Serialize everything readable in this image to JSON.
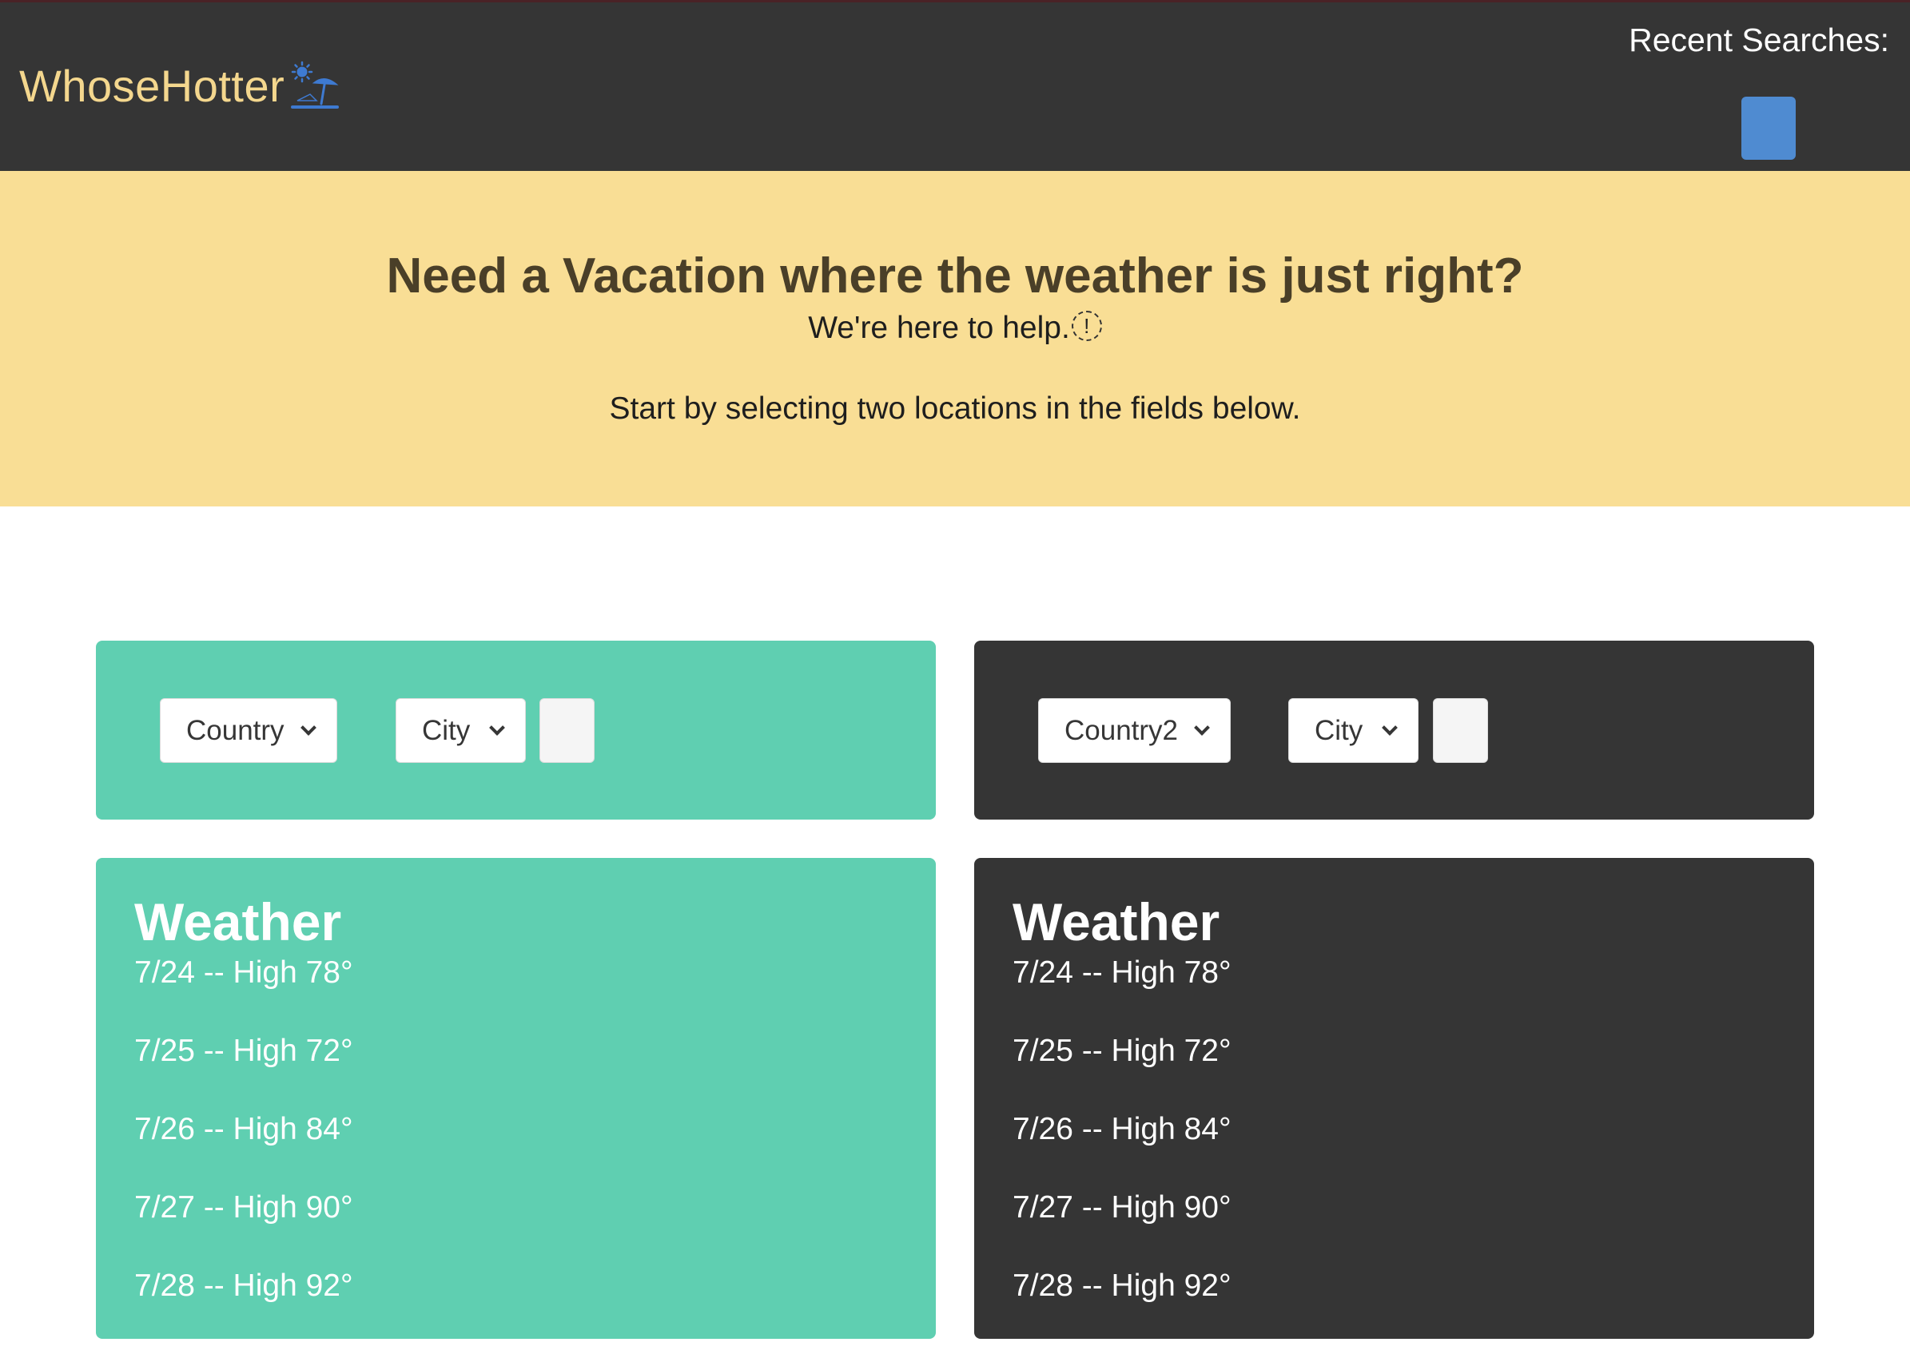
{
  "navbar": {
    "brand": "WhoseHotter",
    "brand_icon": "beach-umbrella-icon",
    "recent_label": "Recent Searches:"
  },
  "hero": {
    "title": "Need a Vacation where the weather is just right?",
    "subtitle": "We're here to help.",
    "info_icon": "!",
    "instruction": "Start by selecting two locations in the fields below."
  },
  "location1": {
    "country_placeholder": "Country",
    "city_placeholder": "City",
    "color": "#5fcfb1"
  },
  "location2": {
    "country_placeholder": "Country2",
    "city_placeholder": "City",
    "color": "#353535"
  },
  "weather1": {
    "title": "Weather",
    "forecast": [
      "7/24 -- High 78°",
      "7/25 -- High 72°",
      "7/26 -- High 84°",
      "7/27 -- High 90°",
      "7/28 -- High 92°"
    ]
  },
  "weather2": {
    "title": "Weather",
    "forecast": [
      "7/24 -- High 78°",
      "7/25 -- High 72°",
      "7/26 -- High 84°",
      "7/27 -- High 90°",
      "7/28 -- High 92°"
    ]
  },
  "colors": {
    "navbar": "#353535",
    "brand": "#f4d78e",
    "hero": "#f9de95",
    "teal": "#5fcfb1",
    "dark": "#353535",
    "accent_button": "#4f8bd1"
  }
}
